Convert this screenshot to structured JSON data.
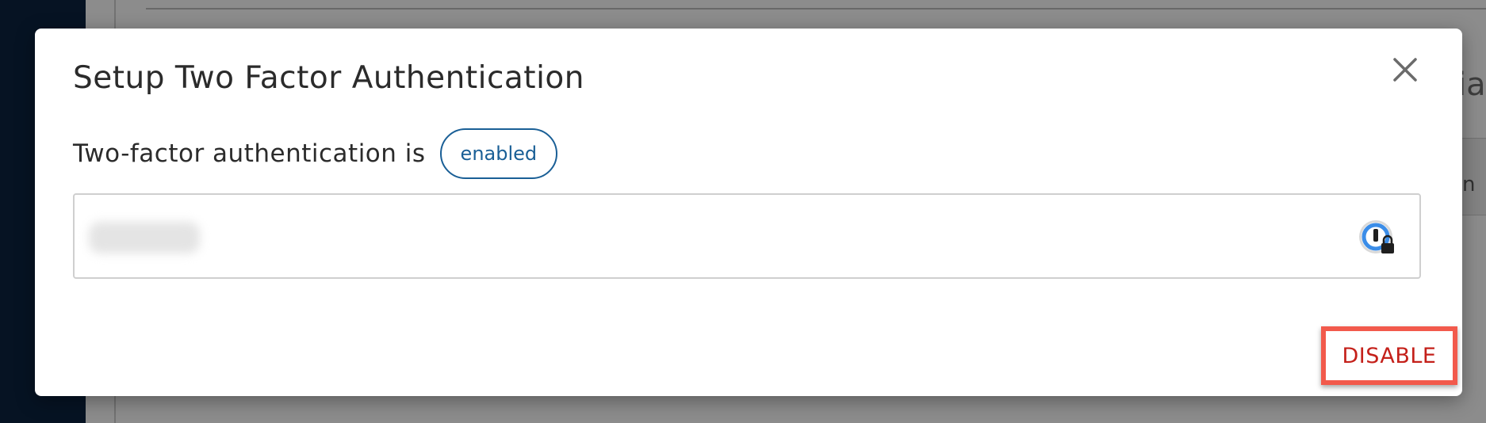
{
  "background": {
    "peek_title": "ia",
    "peek_text": "n"
  },
  "dialog": {
    "title": "Setup Two Factor Authentication",
    "status_label": "Two-factor authentication is",
    "status_badge": "enabled",
    "close_icon": "close-icon",
    "code_field": {
      "value": "",
      "icon": "password-manager-icon"
    },
    "disable_button": "DISABLE"
  },
  "colors": {
    "badge": "#1a5f96",
    "disable_text": "#c4201a",
    "highlight_border": "#f25a4c",
    "password_manager_blue": "#3b8de8"
  }
}
